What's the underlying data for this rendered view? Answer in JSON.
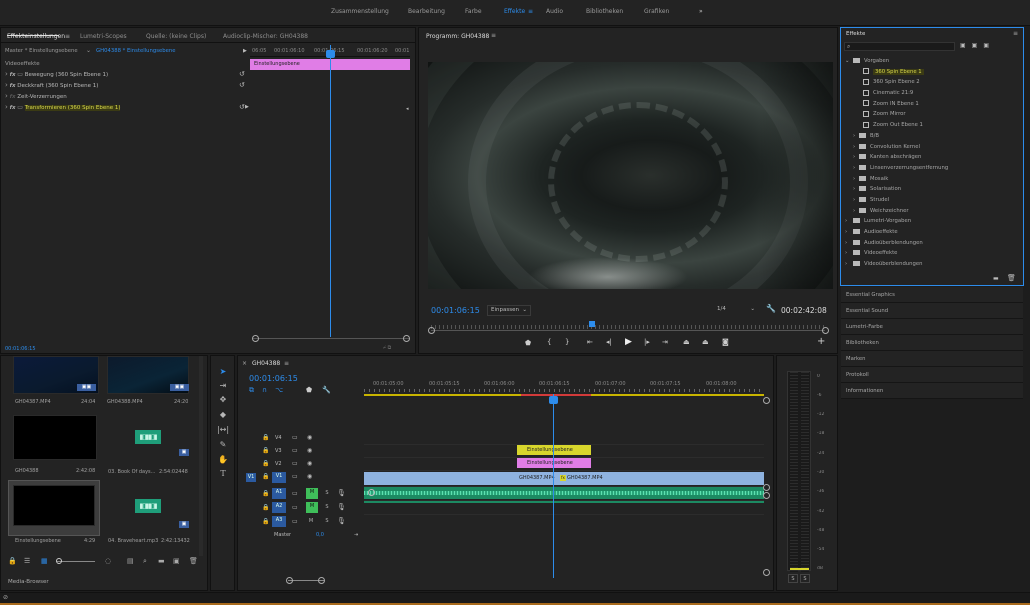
{
  "topbar": {
    "workspaces": [
      "Zusammenstellung",
      "Bearbeitung",
      "Farbe",
      "Effekte",
      "Audio",
      "Bibliotheken",
      "Grafiken"
    ],
    "active_workspace": "Effekte",
    "more": "»"
  },
  "effect_controls": {
    "tabs": [
      "Effekteinstellungen",
      "Lumetri-Scopes",
      "Quelle: (keine Clips)",
      "Audioclip-Mischer: GH04388"
    ],
    "master_label": "Master * Einstellungsebene",
    "clip_label": "GH04388 * Einstellungsebene",
    "section": "Videoeffekte",
    "effects": [
      {
        "name": "Bewegung (360 Spin Ebene 1)",
        "highlight": false
      },
      {
        "name": "Deckkraft (360 Spin Ebene 1)",
        "highlight": false
      },
      {
        "name": "Zeit-Verzerrungen",
        "highlight": false
      },
      {
        "name": "Transformieren (360 Spin Ebene 1)",
        "highlight": true
      }
    ],
    "ruler": [
      "06:05",
      "00:01:06:10",
      "00:01:06:15",
      "00:01:06:20",
      "00:01"
    ],
    "clip_name": "Einstellungsebene",
    "timecode": "00:01:06:15"
  },
  "program": {
    "title": "Programm: GH04388",
    "timecode": "00:01:06:15",
    "fit": "Einpassen",
    "resolution": "1/4",
    "duration": "00:02:42:08"
  },
  "effects_panel": {
    "title": "Effekte",
    "tree": [
      {
        "label": "Vorgaben",
        "kind": "folder",
        "level": 0,
        "open": true
      },
      {
        "label": "360 Spin Ebene 1",
        "kind": "preset",
        "level": 1,
        "highlight": true
      },
      {
        "label": "360 Spin Ebene 2",
        "kind": "preset",
        "level": 1
      },
      {
        "label": "Cinematic 21:9",
        "kind": "preset",
        "level": 1
      },
      {
        "label": "Zoom IN Ebene 1",
        "kind": "preset",
        "level": 1
      },
      {
        "label": "Zoom Mirror",
        "kind": "preset",
        "level": 1
      },
      {
        "label": "Zoom Out Ebene 1",
        "kind": "preset",
        "level": 1
      },
      {
        "label": "B/B",
        "kind": "folder",
        "level": 1
      },
      {
        "label": "Convolution Kernel",
        "kind": "folder",
        "level": 1
      },
      {
        "label": "Kanten abschrägen",
        "kind": "folder",
        "level": 1
      },
      {
        "label": "Linsenverzerrungsentfernung",
        "kind": "folder",
        "level": 1
      },
      {
        "label": "Mosaik",
        "kind": "folder",
        "level": 1
      },
      {
        "label": "Solarisation",
        "kind": "folder",
        "level": 1
      },
      {
        "label": "Strudel",
        "kind": "folder",
        "level": 1
      },
      {
        "label": "Weichzeichner",
        "kind": "folder",
        "level": 1
      },
      {
        "label": "Lumetri-Vorgaben",
        "kind": "folder",
        "level": 0
      },
      {
        "label": "Audioeffekte",
        "kind": "folder",
        "level": 0
      },
      {
        "label": "Audioüberblendungen",
        "kind": "folder",
        "level": 0
      },
      {
        "label": "Videoeffekte",
        "kind": "folder",
        "level": 0
      },
      {
        "label": "Videoüberblendungen",
        "kind": "folder",
        "level": 0
      }
    ]
  },
  "side_panels": [
    "Essential Graphics",
    "Essential Sound",
    "Lumetri-Farbe",
    "Bibliotheken",
    "Marken",
    "Protokoll",
    "Informationen"
  ],
  "media_browser": {
    "label": "Media-Browser",
    "items": [
      {
        "name": "GH04387.MP4",
        "duration": "24:04",
        "kind": "video"
      },
      {
        "name": "GH04388.MP4",
        "duration": "24:20",
        "kind": "video"
      },
      {
        "name": "GH04388",
        "duration": "2:42:08",
        "kind": "black"
      },
      {
        "name": "03. Book Of days...",
        "duration": "2:54:02448",
        "kind": "audio"
      },
      {
        "name": "Einstellungsebene",
        "duration": "4:29",
        "kind": "black"
      },
      {
        "name": "04. Braveheart.mp3",
        "duration": "2:42:13432",
        "kind": "audio"
      }
    ],
    "timecode": "00:01:06:15"
  },
  "timeline": {
    "title": "GH04388",
    "timecode": "00:01:06:15",
    "ruler": [
      "00:01:05:00",
      "00:01:05:15",
      "00:01:06:00",
      "00:01:06:15",
      "00:01:07:00",
      "00:01:07:15",
      "00:01:08:00"
    ],
    "video_tracks": [
      "V4",
      "V3",
      "V2",
      "V1"
    ],
    "audio_tracks": [
      "A1",
      "A2",
      "A3"
    ],
    "master_label": "Master",
    "master_value": "0,0",
    "clips": {
      "v3": "Einstellungsebene",
      "v2": "Einstellungsebene",
      "v1a": "GH04387.MP4",
      "v1b": "GH04387.MP4"
    }
  },
  "meter": {
    "scale": [
      "0",
      "-6",
      "-12",
      "-18",
      "-24",
      "-30",
      "-36",
      "-42",
      "-48",
      "-54",
      "dB"
    ],
    "solo": [
      "S",
      "S"
    ]
  }
}
